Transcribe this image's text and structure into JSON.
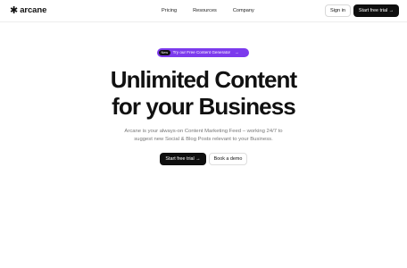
{
  "header": {
    "logo_mark": "✱",
    "logo_text": "arcane",
    "nav": [
      "Pricing",
      "Resources",
      "Company"
    ],
    "signin_label": "Sign in",
    "trial_label": "Start free trial",
    "trial_arrow": "→"
  },
  "announcement": {
    "badge": "New",
    "text": "Try our Free Content Generator",
    "arrow": "→",
    "color": "#7c3aed"
  },
  "hero": {
    "title_line1": "Unlimited Content",
    "title_line2": "for your Business",
    "subtitle_line1": "Arcane is your always-on Content Marketing Feed – working 24/7 to",
    "subtitle_line2": "suggest new Social & Blog Posts relevant to your Business.",
    "primary_cta": "Start free trial",
    "primary_cta_arrow": "→",
    "secondary_cta": "Book a demo"
  }
}
